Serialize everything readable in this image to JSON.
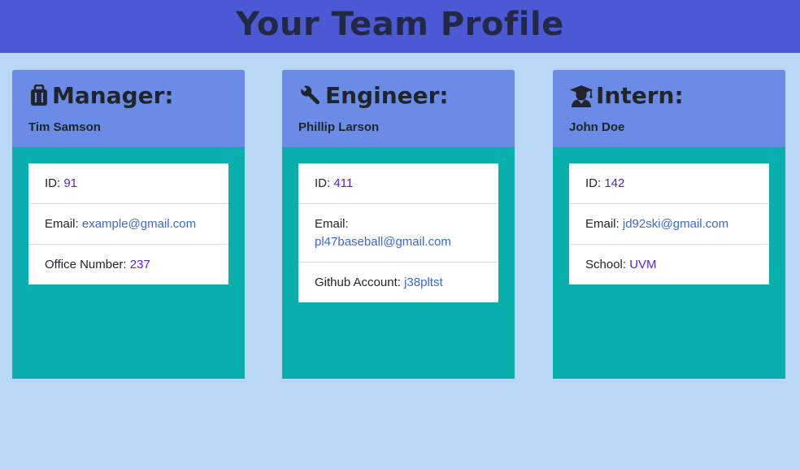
{
  "header": {
    "title": "Your Team Profile"
  },
  "cards": [
    {
      "role": "Manager:",
      "role_icon": "briefcase-icon",
      "name": "Tim Samson",
      "id_label": "ID:",
      "id": "91",
      "email_label": "Email:",
      "email": "example@gmail.com",
      "extra_label": "Office Number:",
      "extra": "237"
    },
    {
      "role": "Engineer:",
      "role_icon": "wrench-icon",
      "name": "Phillip Larson",
      "id_label": "ID:",
      "id": "411",
      "email_label": "Email:",
      "email": "pl47baseball@gmail.com",
      "extra_label": "Github Account:",
      "extra": "j38pltst"
    },
    {
      "role": "Intern:",
      "role_icon": "graduate-icon",
      "name": "John Doe",
      "id_label": "ID:",
      "id": "142",
      "email_label": "Email:",
      "email": "jd92ski@gmail.com",
      "extra_label": "School:",
      "extra": "UVM"
    }
  ],
  "colors": {
    "header_bg": "#4b59d4",
    "page_bg": "#b9d8f5",
    "card_head_bg": "#6a8ce6",
    "card_body_bg": "#08afad",
    "value_purple": "#5a1fd6",
    "link_blue": "#3a6ad6"
  }
}
